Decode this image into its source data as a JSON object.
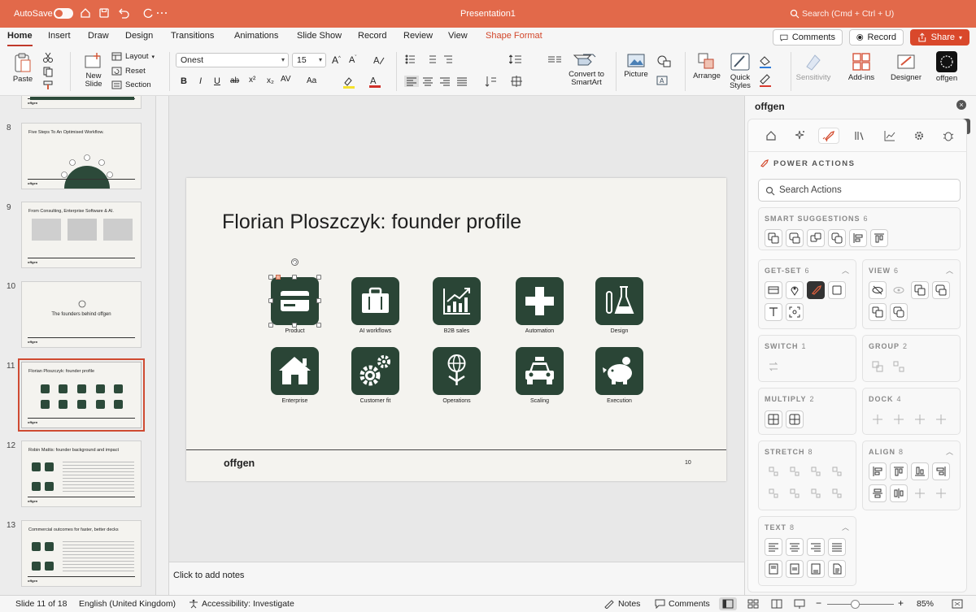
{
  "titlebar": {
    "autosave_label": "AutoSave",
    "document_title": "Presentation1",
    "search_placeholder": "Search (Cmd + Ctrl + U)",
    "accent_color": "#e2694a"
  },
  "tabs": [
    {
      "label": "Home",
      "active": true
    },
    {
      "label": "Insert"
    },
    {
      "label": "Draw"
    },
    {
      "label": "Design"
    },
    {
      "label": "Transitions"
    },
    {
      "label": "Animations"
    },
    {
      "label": "Slide Show"
    },
    {
      "label": "Record"
    },
    {
      "label": "Review"
    },
    {
      "label": "View"
    },
    {
      "label": "Shape Format",
      "accent": true
    }
  ],
  "header_buttons": {
    "comments": "Comments",
    "record": "Record",
    "share": "Share"
  },
  "ribbon": {
    "paste": "Paste",
    "new_slide_1": "New",
    "new_slide_2": "Slide",
    "layout": "Layout",
    "reset": "Reset",
    "section": "Section",
    "font_name": "Onest",
    "font_size": "15",
    "convert_1": "Convert to",
    "convert_2": "SmartArt",
    "picture": "Picture",
    "arrange": "Arrange",
    "quick_styles_1": "Quick",
    "quick_styles_2": "Styles",
    "sensitivity": "Sensitivity",
    "addins": "Add-ins",
    "designer": "Designer",
    "offgen": "offgen",
    "format_glyphs": {
      "bold": "B",
      "italic": "I",
      "underline": "U",
      "strike": "ab",
      "sup": "x²",
      "sub": "x₂",
      "spacing": "AV",
      "case": "Aa"
    }
  },
  "slides": [
    {
      "num": "8",
      "title": "Five Steps To An Optimised Workflow."
    },
    {
      "num": "9",
      "title": "From Consulting, Enterprise Software & AI."
    },
    {
      "num": "10",
      "title": "The founders behind offgen"
    },
    {
      "num": "11",
      "title": "Florian Ploszczyk: founder profile",
      "selected": true
    },
    {
      "num": "12",
      "title": "Robin Mattis: founder background and impact"
    },
    {
      "num": "13",
      "title": "Commercial outcomes for faster, better decks"
    }
  ],
  "thumb_logo": "offgen",
  "main_slide": {
    "title": "Florian Ploszczyk: founder profile",
    "icons": [
      {
        "label": "Product",
        "icon": "credit-card-icon"
      },
      {
        "label": "AI workflows",
        "icon": "briefcase-icon"
      },
      {
        "label": "B2B sales",
        "icon": "growth-chart-icon"
      },
      {
        "label": "Automation",
        "icon": "plus-cross-icon"
      },
      {
        "label": "Design",
        "icon": "lab-flask-icon"
      },
      {
        "label": "Enterprise",
        "icon": "house-icon"
      },
      {
        "label": "Customer fit",
        "icon": "gears-icon"
      },
      {
        "label": "Operations",
        "icon": "globe-person-icon"
      },
      {
        "label": "Scaling",
        "icon": "taxi-icon"
      },
      {
        "label": "Execution",
        "icon": "piggy-bank-icon"
      }
    ],
    "logo": "offgen",
    "page_number": "10",
    "icon_color": "#2a4536"
  },
  "notes_placeholder": "Click to add notes",
  "panel": {
    "title": "offgen",
    "section_title": "POWER ACTIONS",
    "search_placeholder": "Search Actions",
    "cards": [
      {
        "id": "smart",
        "title": "SMART SUGGESTIONS",
        "count": "6"
      },
      {
        "id": "getset",
        "title": "GET-SET",
        "count": "6"
      },
      {
        "id": "view",
        "title": "VIEW",
        "count": "6"
      },
      {
        "id": "switch",
        "title": "SWITCH",
        "count": "1"
      },
      {
        "id": "group",
        "title": "GROUP",
        "count": "2"
      },
      {
        "id": "multiply",
        "title": "MULTIPLY",
        "count": "2"
      },
      {
        "id": "dock",
        "title": "DOCK",
        "count": "4"
      },
      {
        "id": "stretch",
        "title": "STRETCH",
        "count": "8"
      },
      {
        "id": "align",
        "title": "ALIGN",
        "count": "8"
      },
      {
        "id": "text",
        "title": "TEXT",
        "count": "8"
      }
    ]
  },
  "status": {
    "slide_info": "Slide 11 of 18",
    "language": "English (United Kingdom)",
    "accessibility": "Accessibility: Investigate",
    "notes": "Notes",
    "comments": "Comments",
    "zoom": "85%",
    "zoom_minus": "−",
    "zoom_plus": "+"
  }
}
